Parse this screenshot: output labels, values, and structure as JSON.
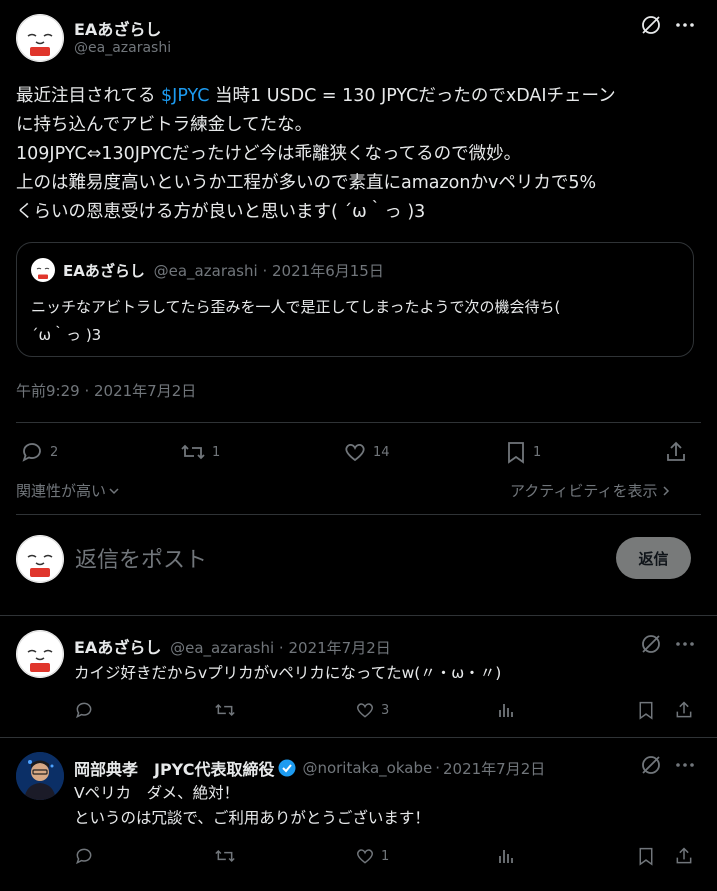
{
  "main_tweet": {
    "display_name": "EAあざらし",
    "handle": "@ea_azarashi",
    "body_lines": {
      "l1_pre": "最近注目されてる ",
      "l1_cashtag": "$JPYC",
      "l1_post": " 当時1 USDC = 130 JPYCだったのでxDAIチェーン",
      "l2": "に持ち込んでアビトラ練金してたな。",
      "l3": "109JPYC⇔130JPYCだったけど今は乖離狭くなってるので微妙。",
      "l4": "上のは難易度高いというか工程が多いので素直にamazonかvペリカで5%",
      "l5": "くらいの恩恵受ける方が良いと思います( ´ω｀っ )3"
    },
    "timestamp": "午前9:29 · 2021年7月2日",
    "stats": {
      "replies": "2",
      "retweets": "1",
      "likes": "14",
      "bookmarks": "1"
    },
    "sort_label": "関連性が高い",
    "activity_label": "アクティビティを表示"
  },
  "quoted_tweet": {
    "display_name": "EAあざらし",
    "handle": "@ea_azarashi",
    "date": "2021年6月15日",
    "line1": "ニッチなアビトラしてたら歪みを一人で是正してしまったようで次の機会待ち(",
    "line2": "´ω｀っ )3"
  },
  "composer": {
    "placeholder": "返信をポスト",
    "reply_button": "返信"
  },
  "replies": [
    {
      "display_name": "EAあざらし",
      "handle": "@ea_azarashi",
      "date": "2021年7月2日",
      "lines": [
        "カイジ好きだからvプリカがvペリカになってたw(〃・ω・〃)"
      ],
      "stats": {
        "replies": "",
        "retweets": "",
        "likes": "3"
      }
    },
    {
      "display_name": "岡部典孝　JPYC代表取締役",
      "handle": "@noritaka_okabe",
      "date": "2021年7月2日",
      "lines": [
        "Vペリカ　ダメ、絶対！",
        "というのは冗談で、ご利用ありがとうございます！"
      ],
      "stats": {
        "replies": "",
        "retweets": "",
        "likes": "1"
      }
    }
  ],
  "separator": "·",
  "icons": [
    "grok-icon",
    "more-icon",
    "reply-icon",
    "retweet-icon",
    "like-icon",
    "bookmark-icon",
    "share-icon",
    "views-icon",
    "verified-icon",
    "chevron-down-icon",
    "chevron-right-icon"
  ],
  "colors": {
    "background": "#000000",
    "text": "#e7e9ea",
    "muted": "#71767b",
    "link": "#1d9bf0",
    "divider": "#2f3336",
    "reply_button_bg": "#787a7a"
  }
}
